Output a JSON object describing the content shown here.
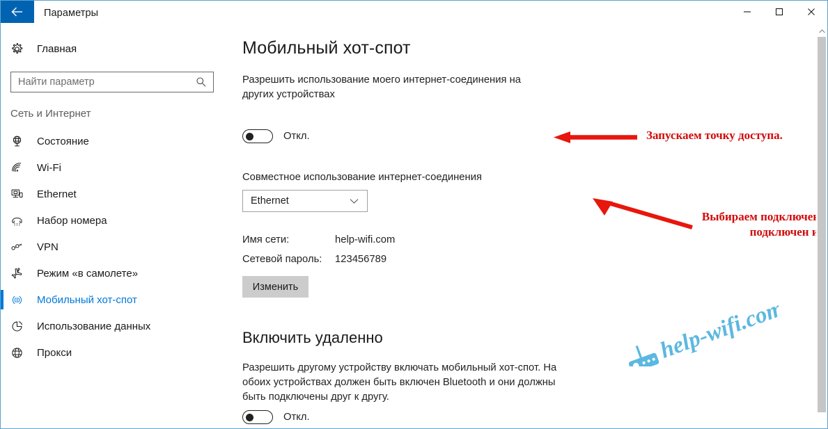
{
  "window": {
    "title": "Параметры",
    "back_icon": "back-arrow-icon",
    "minimize_label": "—",
    "maximize_label": "□",
    "close_label": "✕"
  },
  "sidebar": {
    "home": {
      "label": "Главная",
      "icon": "gear-icon"
    },
    "search": {
      "placeholder": "Найти параметр",
      "value": "",
      "icon": "search-icon"
    },
    "section_title": "Сеть и Интернет",
    "items": [
      {
        "label": "Состояние",
        "icon": "globe-status-icon",
        "selected": false
      },
      {
        "label": "Wi-Fi",
        "icon": "wifi-icon",
        "selected": false
      },
      {
        "label": "Ethernet",
        "icon": "ethernet-icon",
        "selected": false
      },
      {
        "label": "Набор номера",
        "icon": "dialup-phone-icon",
        "selected": false
      },
      {
        "label": "VPN",
        "icon": "vpn-key-icon",
        "selected": false
      },
      {
        "label": "Режим «в самолете»",
        "icon": "airplane-icon",
        "selected": false
      },
      {
        "label": "Мобильный хот-спот",
        "icon": "hotspot-broadcast-icon",
        "selected": true
      },
      {
        "label": "Использование данных",
        "icon": "pie-chart-icon",
        "selected": false
      },
      {
        "label": "Прокси",
        "icon": "globe-proxy-icon",
        "selected": false
      }
    ],
    "accent_color": "#0078d7"
  },
  "main": {
    "page_title": "Мобильный хот-спот",
    "description_1": "Разрешить использование моего интернет-соединения на других устройствах",
    "toggle_1": {
      "state_label": "Откл.",
      "on": false
    },
    "share_label": "Совместное использование интернет-соединения",
    "share_select": {
      "value": "Ethernet",
      "options": [
        "Ethernet"
      ],
      "icon": "chevron-down-icon"
    },
    "info_rows": [
      {
        "key": "Имя сети:",
        "value": "help-wifi.com"
      },
      {
        "key": "Сетевой пароль:",
        "value": "123456789"
      }
    ],
    "edit_button": "Изменить",
    "section_2_title": "Включить удаленно",
    "description_2": "Разрешить другому устройству включать мобильный хот-спот. На обоих устройствах должен быть включен Bluetooth и они должны быть подключены друг к другу.",
    "toggle_2": {
      "state_label": "Откл.",
      "on": false
    }
  },
  "annotations": {
    "color": "#d20a0a",
    "note_1": "Запускаем точку доступа.",
    "note_2": "Выбираем подключение, через которое подключен интернет.",
    "arrow_1": "left-arrow",
    "arrow_2": "diagonal-left-arrow"
  },
  "watermark": {
    "text": "help-wifi.com",
    "icon": "router-icon",
    "color": "#5cb8e0"
  },
  "scrollbar": {
    "up_arrow": "chevron-up-icon"
  }
}
